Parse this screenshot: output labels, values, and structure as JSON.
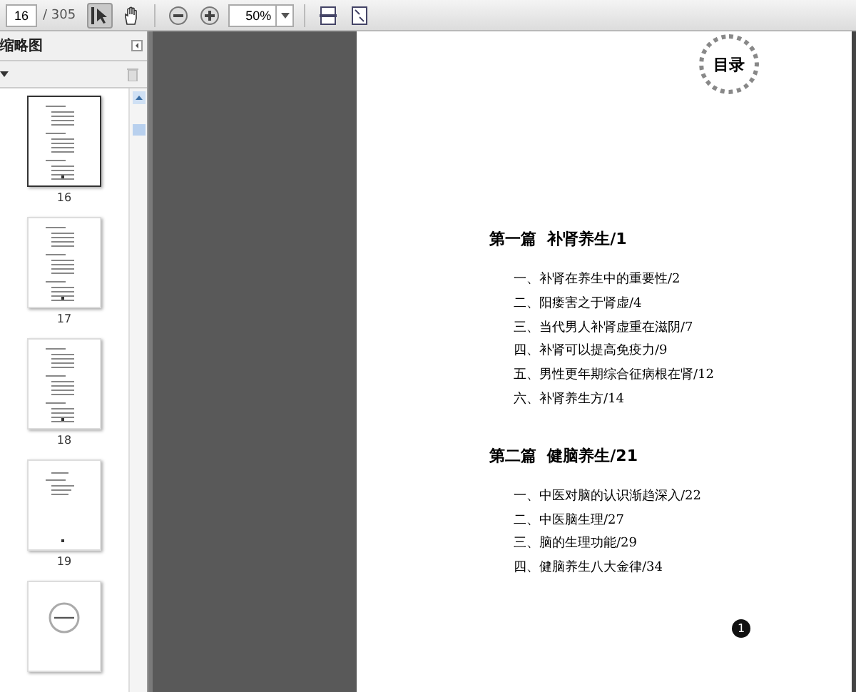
{
  "toolbar": {
    "page_field": {
      "value": "16"
    },
    "page_total": "/ 305",
    "tools": [
      {
        "kind": "select",
        "selected": true
      },
      {
        "kind": "hand",
        "selected": false
      }
    ],
    "zoom_field": {
      "value": "50%"
    }
  },
  "sidebar": {
    "title": "缩略图",
    "thumbnails": [
      {
        "kind": "toc",
        "label": "16",
        "selected": true
      },
      {
        "kind": "toc",
        "label": "17",
        "selected": false
      },
      {
        "kind": "toc",
        "label": "18",
        "selected": false
      },
      {
        "kind": "short",
        "label": "19",
        "selected": false
      },
      {
        "kind": "cover",
        "selected": false
      }
    ]
  },
  "document": {
    "title": "目录",
    "sections": [
      {
        "heading": "第一篇  补肾养生/1",
        "items": [
          "一、补肾在养生中的重要性/2",
          "二、阳痿害之于肾虚/4",
          "三、当代男人补肾虚重在滋阴/7",
          "四、补肾可以提高免疫力/9",
          "五、男性更年期综合征病根在肾/12",
          "六、补肾养生方/14"
        ]
      },
      {
        "heading": "第二篇  健脑养生/21",
        "items": [
          "一、中医对脑的认识渐趋深入/22",
          "二、中医脑生理/27",
          "三、脑的生理功能/29",
          "四、健脑养生八大金律/34"
        ]
      }
    ],
    "page_number": "1"
  }
}
